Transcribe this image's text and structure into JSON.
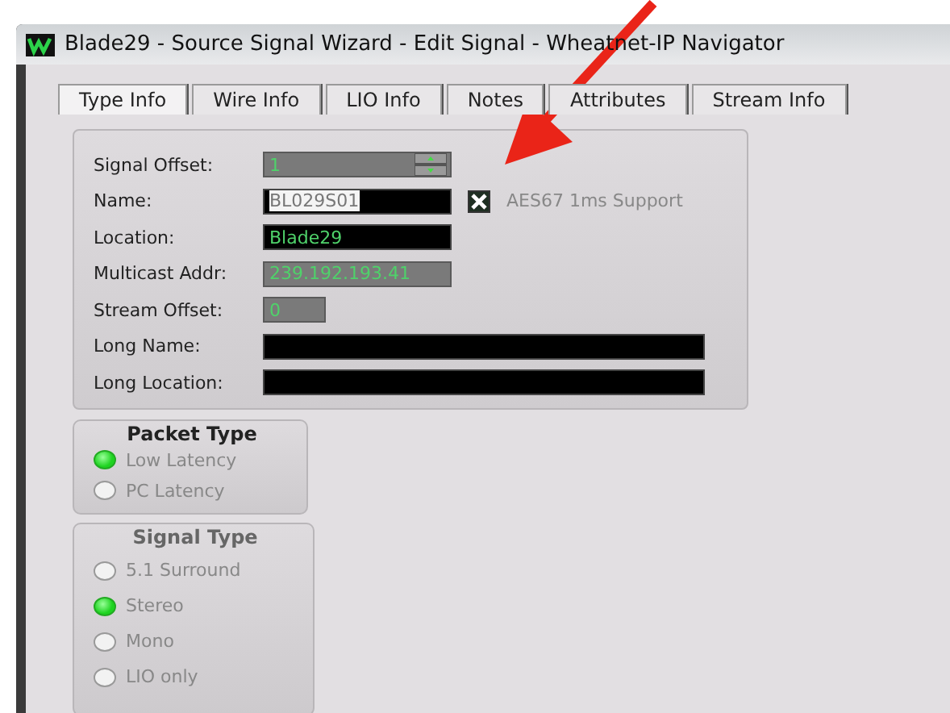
{
  "window": {
    "title": "Blade29 - Source Signal Wizard - Edit Signal - Wheatnet-IP Navigator"
  },
  "tabs": [
    {
      "label": "Type Info",
      "selected": true
    },
    {
      "label": "Wire Info",
      "selected": false
    },
    {
      "label": "LIO Info",
      "selected": false
    },
    {
      "label": "Notes",
      "selected": false
    },
    {
      "label": "Attributes",
      "selected": false
    },
    {
      "label": "Stream Info",
      "selected": false
    }
  ],
  "fields": [
    {
      "label": "Signal Offset:",
      "kind": "spinner",
      "value": "1"
    },
    {
      "label": "Name:",
      "kind": "entry",
      "value": "BL029S01",
      "text_selected": true,
      "checkbox": {
        "label": "AES67 1ms Support",
        "checked": true
      }
    },
    {
      "label": "Location:",
      "kind": "entry",
      "value": "Blade29"
    },
    {
      "label": "Multicast Addr:",
      "kind": "display",
      "value": "239.192.193.41"
    },
    {
      "label": "Stream Offset:",
      "kind": "counter",
      "value": "0"
    },
    {
      "label": "Long Name:",
      "kind": "longentry"
    },
    {
      "label": "Long Location:",
      "kind": "longentry"
    }
  ],
  "groups": [
    {
      "title": "Packet Type",
      "options": [
        {
          "label": "Low Latency",
          "selected": true
        },
        {
          "label": "PC Latency",
          "selected": false
        }
      ]
    },
    {
      "title": "Signal Type",
      "options": [
        {
          "label": "5.1 Surround",
          "selected": false
        },
        {
          "label": "Stereo",
          "selected": true
        },
        {
          "label": "Mono",
          "selected": false
        },
        {
          "label": "LIO only",
          "selected": false
        }
      ]
    }
  ]
}
